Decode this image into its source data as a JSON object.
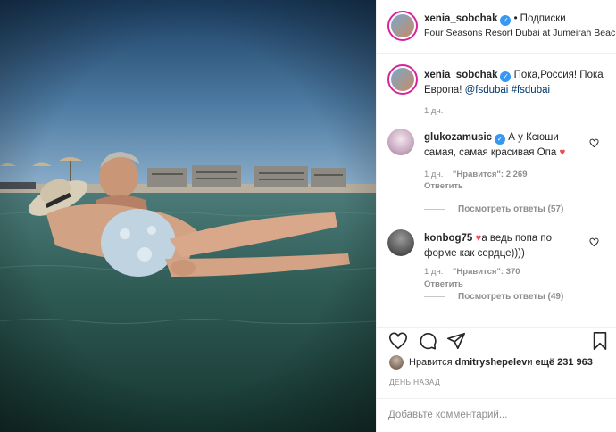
{
  "header": {
    "username": "xenia_sobchak",
    "dot": "•",
    "follow_label": "Подписки",
    "location": "Four Seasons Resort Dubai at Jumeirah Beach",
    "more": "•••"
  },
  "caption": {
    "username": "xenia_sobchak",
    "text_before": " Пока,Россия! Пока Европа! ",
    "mention": "@fsdubai",
    "hashtag": "#fsdubai",
    "time": "1 дн."
  },
  "comments": [
    {
      "username": "glukozamusic",
      "text": " А у Ксюши самая, самая красивая Опа ",
      "time": "1 дн.",
      "likes": "\"Нравится\": 2 269",
      "reply": "Ответить",
      "view_replies": "Посмотреть ответы (57)"
    },
    {
      "username": "konbog75",
      "text": "а ведь попа по форме как сердце))))",
      "time": "1 дн.",
      "likes": "\"Нравится\": 370",
      "reply": "Ответить",
      "view_replies": "Посмотреть ответы (49)"
    }
  ],
  "likes": {
    "prefix": "Нравится ",
    "user": "dmitryshepelev",
    "middle": " и ",
    "count": "ещё 231 963"
  },
  "date": "ДЕНЬ НАЗАД",
  "add_comment_placeholder": "Добавьте комментарий...",
  "colors": {
    "verified": "#3897f0",
    "heart": "#ed4956",
    "link": "#00376b",
    "muted": "#8e8e8e"
  },
  "icons": [
    "heart-icon",
    "comment-icon",
    "share-icon",
    "bookmark-icon",
    "verified-icon",
    "more-icon"
  ]
}
